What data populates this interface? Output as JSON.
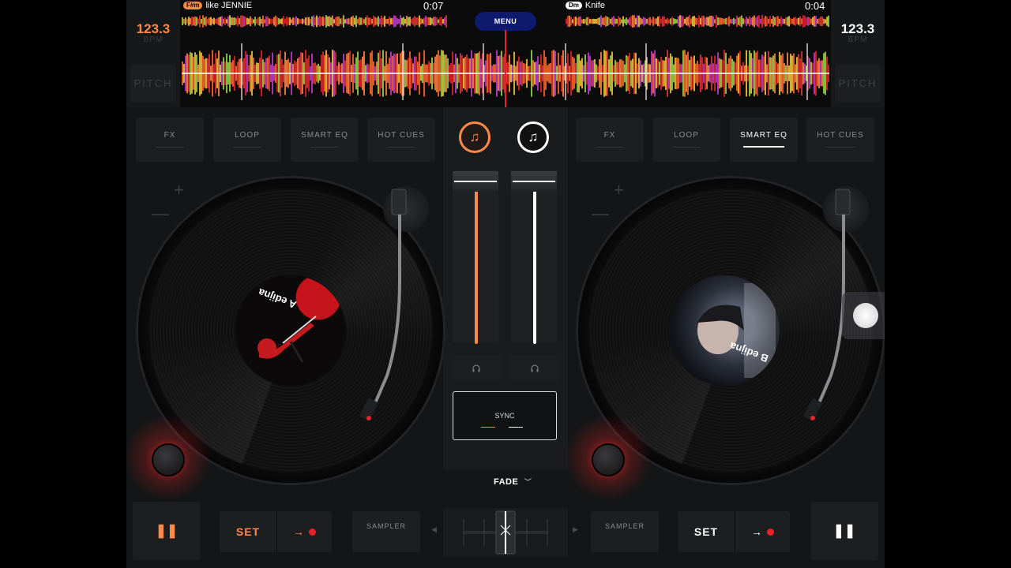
{
  "deck_a": {
    "bpm": "123.3",
    "bpm_label": "BPM",
    "pitch_label": "PITCH",
    "key": "F#m",
    "track_title": "like JENNIE",
    "time": "0:07",
    "accent": "#ff8a48",
    "controls": [
      "FX",
      "LOOP",
      "SMART EQ",
      "HOT CUES"
    ],
    "active_control": null,
    "pause_glyph": "❚❚",
    "set_label": "SET",
    "sampler_label": "SAMPLER",
    "label_text": "A edijna"
  },
  "deck_b": {
    "bpm": "123.3",
    "bpm_label": "BPM",
    "pitch_label": "PITCH",
    "key": "Dm",
    "track_title": "Knife",
    "time": "0:04",
    "accent": "#ffffff",
    "controls": [
      "FX",
      "LOOP",
      "SMART EQ",
      "HOT CUES"
    ],
    "active_control": "SMART EQ",
    "pause_glyph": "❚❚",
    "set_label": "SET",
    "sampler_label": "SAMPLER",
    "label_text": "B edijna"
  },
  "menu_label": "MENU",
  "sync_label": "SYNC",
  "fade_label": "FADE",
  "icons": {
    "library": "music-note-plus-icon",
    "headphones": "headphones-icon",
    "chevron": "chevron-down-icon",
    "arrow": "arrow-right-icon",
    "rec": "record-dot-icon"
  },
  "volume_a": 0.94,
  "volume_b": 0.94,
  "crossfader": 0.5
}
